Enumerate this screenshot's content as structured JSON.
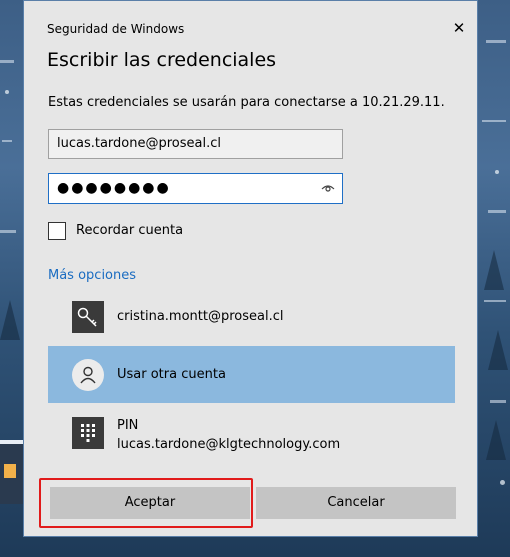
{
  "window": {
    "caption": "Seguridad de Windows",
    "close_glyph": "✕"
  },
  "dialog": {
    "title": "Escribir las credenciales",
    "description": "Estas credenciales se usarán para conectarse a 10.21.29.11."
  },
  "form": {
    "username_value": "lucas.tardone@proseal.cl",
    "password_mask": "●●●●●●●●",
    "remember_label": "Recordar cuenta",
    "remember_checked": false
  },
  "more_options": {
    "label": "Más opciones",
    "accounts": [
      {
        "line1": "cristina.montt@proseal.cl",
        "icon": "key-icon"
      },
      {
        "line1": "Usar otra cuenta",
        "icon": "user-icon",
        "selected": true
      },
      {
        "line1": "PIN",
        "line2": "lucas.tardone@klgtechnology.com",
        "icon": "keypad-icon"
      }
    ]
  },
  "buttons": {
    "ok_label": "Aceptar",
    "cancel_label": "Cancelar"
  },
  "colors": {
    "link": "#1a6cc1",
    "selected_row": "#8bb8de",
    "focus_border": "#1f6fc6",
    "annotation": "#e11b1b"
  }
}
